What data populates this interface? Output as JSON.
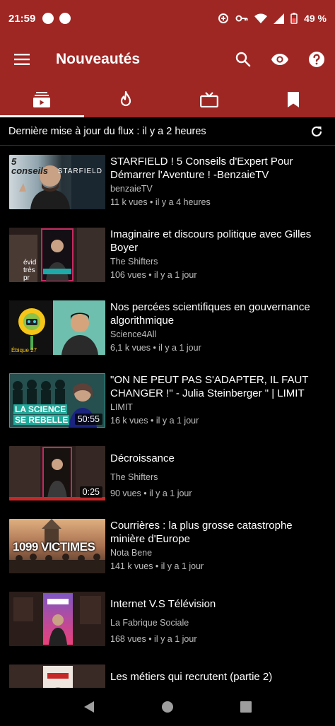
{
  "status": {
    "time": "21:59",
    "battery": "49 %"
  },
  "appbar": {
    "title": "Nouveautés"
  },
  "feed": {
    "last_update": "Dernière mise à jour du flux : il y a 2 heures"
  },
  "videos": [
    {
      "title": "STARFIELD ! 5 Conseils d'Expert Pour Démarrer l'Aventure ! -BenzaieTV",
      "channel": "benzaieTV",
      "info": "11 k vues • il y a 4 heures",
      "duration": "",
      "thumb_text": "5 conseils",
      "thumb_text2": "STARFIELD"
    },
    {
      "title": "Imaginaire et discours politique avec Gilles Boyer",
      "channel": "The Shifters",
      "info": "106 vues • il y a 1 jour",
      "duration": "",
      "thumb_text": "évid très pr",
      "thumb_text2": ""
    },
    {
      "title": "Nos percées scientifiques en gouvernance algorithmique",
      "channel": "Science4All",
      "info": "6,1 k vues • il y a 1 jour",
      "duration": "",
      "thumb_text": "Ébique 27",
      "thumb_text2": ""
    },
    {
      "title": "\"ON NE PEUT PAS S'ADAPTER, IL FAUT CHANGER !\" - Julia Steinberger \" | LIMIT",
      "channel": "LIMIT",
      "info": "16 k vues • il y a 1 jour",
      "duration": "50:55",
      "thumb_text": "LA SCIENCE",
      "thumb_text2": "SE REBELLE"
    },
    {
      "title": "Décroissance",
      "channel": "The Shifters",
      "info": "90 vues • il y a 1 jour",
      "duration": "0:25",
      "thumb_text": "",
      "thumb_text2": ""
    },
    {
      "title": "Courrières : la plus grosse catastrophe minière d'Europe",
      "channel": "Nota Bene",
      "info": "141 k vues • il y a 1 jour",
      "duration": "",
      "thumb_text": "1099 VICTIMES",
      "thumb_text2": ""
    },
    {
      "title": "Internet V.S Télévision",
      "channel": "La Fabrique Sociale",
      "info": "168 vues • il y a 1 jour",
      "duration": "",
      "thumb_text": "",
      "thumb_text2": ""
    },
    {
      "title": "Les métiers qui recrutent (partie 2)",
      "channel": "",
      "info": "",
      "duration": "",
      "thumb_text": "",
      "thumb_text2": ""
    }
  ]
}
